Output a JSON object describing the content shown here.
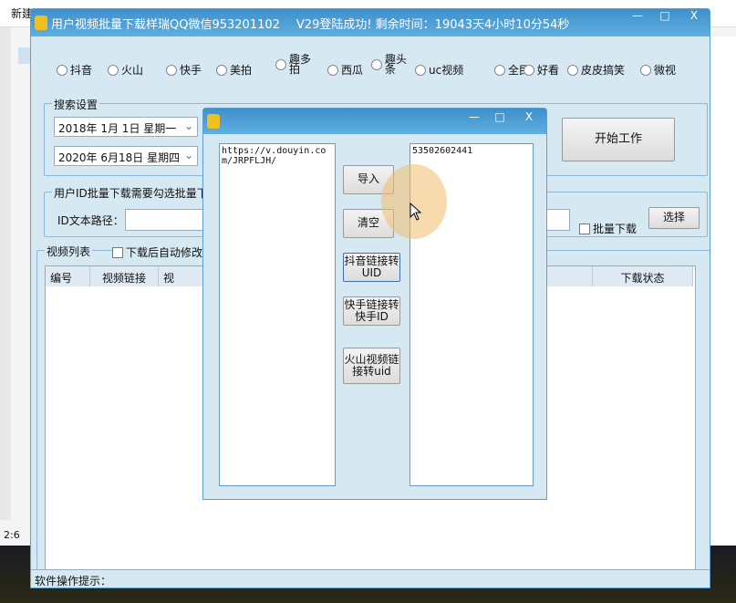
{
  "background": {
    "toolbar_new": "新建",
    "line_col": "2:6"
  },
  "window": {
    "title": "用户视频批量下载样瑞QQ微信953201102",
    "status": "V29登陆成功! 剩余时间：19043天4小时10分54秒",
    "min": "—",
    "max": "□",
    "close": "X"
  },
  "platforms": [
    "抖音",
    "火山",
    "快手",
    "美拍",
    "趣多拍",
    "西瓜",
    "趣头条",
    "uc视频",
    "全民",
    "好看",
    "皮皮搞笑",
    "微视"
  ],
  "search": {
    "label": "搜索设置",
    "start_date": "2018年 1月 1日 星期一",
    "end_date": "2020年 6月18日 星期四",
    "start_button": "开始工作"
  },
  "batch": {
    "label": "用户ID批量下载需要勾选批量下",
    "path_label": "ID文本路径：",
    "path_value": "",
    "batch_checkbox": "批量下载",
    "choose_button": "选择"
  },
  "list": {
    "label": "视频列表",
    "auto_rename": "下载后自动修改",
    "columns": [
      "编号",
      "视频链接",
      "视",
      "下载状态"
    ]
  },
  "statusbar": {
    "hint": "软件操作提示："
  },
  "dialog": {
    "input_text": "https://v.douyin.com/JRPFLJH/",
    "output_text": "53502602441",
    "import": "导入",
    "clear": "清空",
    "douyin_uid": "抖音链接转UID",
    "kuaishou_id": "快手链接转快手ID",
    "huoshan_uid": "火山视频链接转uid",
    "min": "—",
    "max": "□",
    "close": "X"
  }
}
